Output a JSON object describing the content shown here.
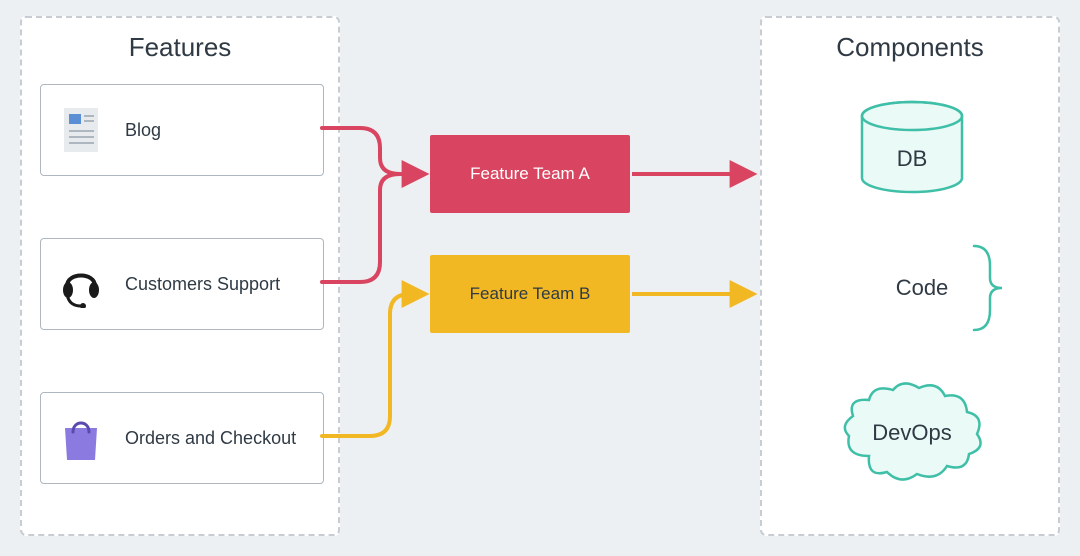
{
  "panels": {
    "features_title": "Features",
    "components_title": "Components"
  },
  "features": {
    "blog": "Blog",
    "customers_support": "Customers Support",
    "orders_checkout": "Orders and Checkout"
  },
  "teams": {
    "a": "Feature Team A",
    "b": "Feature Team B"
  },
  "components": {
    "db": "DB",
    "code": "Code",
    "devops": "DevOps"
  },
  "colors": {
    "team_a": "#d94560",
    "team_b": "#f2b824",
    "teal": "#3fbfa7"
  }
}
